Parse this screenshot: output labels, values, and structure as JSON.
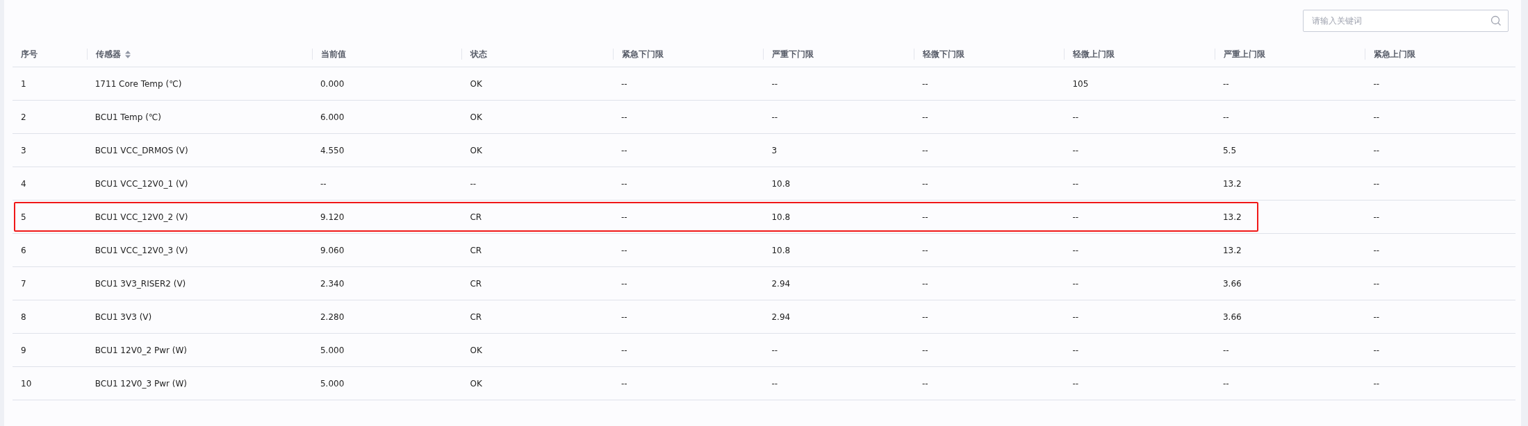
{
  "search": {
    "placeholder": "请输入关键词"
  },
  "table": {
    "columns": [
      {
        "label": "序号",
        "sortable": false
      },
      {
        "label": "传感器",
        "sortable": true
      },
      {
        "label": "当前值",
        "sortable": false
      },
      {
        "label": "状态",
        "sortable": false
      },
      {
        "label": "紧急下门限",
        "sortable": false
      },
      {
        "label": "严重下门限",
        "sortable": false
      },
      {
        "label": "轻微下门限",
        "sortable": false
      },
      {
        "label": "轻微上门限",
        "sortable": false
      },
      {
        "label": "严重上门限",
        "sortable": false
      },
      {
        "label": "紧急上门限",
        "sortable": false
      }
    ],
    "rows": [
      {
        "highlighted": false,
        "cells": [
          "1",
          "1711 Core Temp (℃)",
          "0.000",
          "OK",
          "--",
          "--",
          "--",
          "105",
          "--",
          "--"
        ]
      },
      {
        "highlighted": false,
        "cells": [
          "2",
          "BCU1 Temp (℃)",
          "6.000",
          "OK",
          "--",
          "--",
          "--",
          "--",
          "--",
          "--"
        ]
      },
      {
        "highlighted": false,
        "cells": [
          "3",
          "BCU1 VCC_DRMOS (V)",
          "4.550",
          "OK",
          "--",
          "3",
          "--",
          "--",
          "5.5",
          "--"
        ]
      },
      {
        "highlighted": false,
        "cells": [
          "4",
          "BCU1 VCC_12V0_1 (V)",
          "--",
          "--",
          "--",
          "10.8",
          "--",
          "--",
          "13.2",
          "--"
        ]
      },
      {
        "highlighted": true,
        "cells": [
          "5",
          "BCU1 VCC_12V0_2 (V)",
          "9.120",
          "CR",
          "--",
          "10.8",
          "--",
          "--",
          "13.2",
          "--"
        ]
      },
      {
        "highlighted": false,
        "cells": [
          "6",
          "BCU1 VCC_12V0_3 (V)",
          "9.060",
          "CR",
          "--",
          "10.8",
          "--",
          "--",
          "13.2",
          "--"
        ]
      },
      {
        "highlighted": false,
        "cells": [
          "7",
          "BCU1 3V3_RISER2 (V)",
          "2.340",
          "CR",
          "--",
          "2.94",
          "--",
          "--",
          "3.66",
          "--"
        ]
      },
      {
        "highlighted": false,
        "cells": [
          "8",
          "BCU1 3V3 (V)",
          "2.280",
          "CR",
          "--",
          "2.94",
          "--",
          "--",
          "3.66",
          "--"
        ]
      },
      {
        "highlighted": false,
        "cells": [
          "9",
          "BCU1 12V0_2 Pwr (W)",
          "5.000",
          "OK",
          "--",
          "--",
          "--",
          "--",
          "--",
          "--"
        ]
      },
      {
        "highlighted": false,
        "cells": [
          "10",
          "BCU1 12V0_3 Pwr (W)",
          "5.000",
          "OK",
          "--",
          "--",
          "--",
          "--",
          "--",
          "--"
        ]
      }
    ]
  }
}
